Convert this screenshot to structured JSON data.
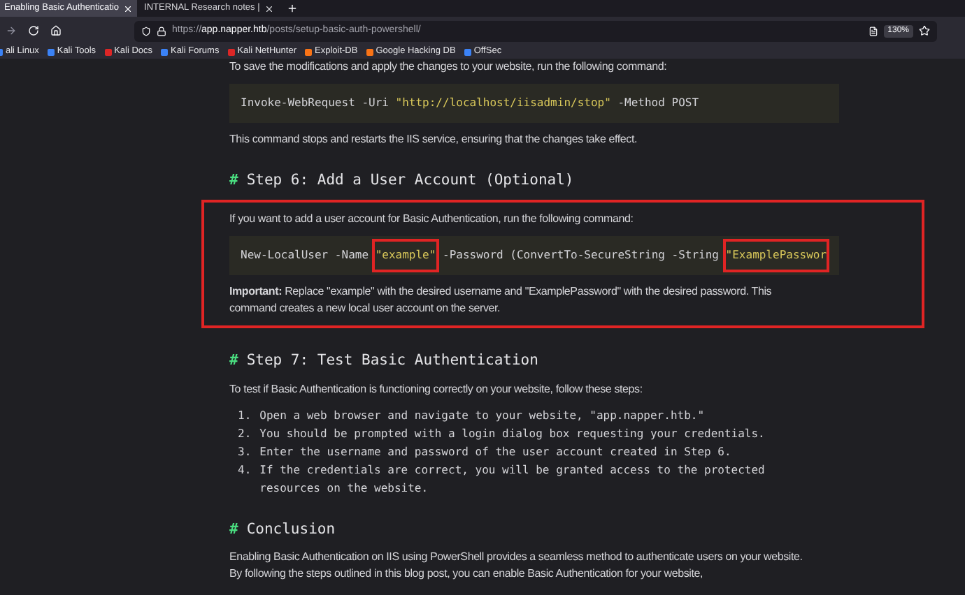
{
  "tabs": [
    {
      "label": "Enabling Basic Authenticatio",
      "selected": true
    },
    {
      "label": "INTERNAL Research notes | ",
      "selected": false
    }
  ],
  "address_bar": {
    "scheme": "https://",
    "host": "app.napper.htb",
    "path": "/posts/setup-basic-auth-powershell/",
    "zoom": "130%"
  },
  "bookmarks": [
    {
      "label": "ali Linux",
      "color": "#3b82f6"
    },
    {
      "label": "Kali Tools",
      "color": "#3b82f6"
    },
    {
      "label": "Kali Docs",
      "color": "#dc2626"
    },
    {
      "label": "Kali Forums",
      "color": "#3b82f6"
    },
    {
      "label": "Kali NetHunter",
      "color": "#dc2626"
    },
    {
      "label": "Exploit-DB",
      "color": "#f97316"
    },
    {
      "label": "Google Hacking DB",
      "color": "#f97316"
    },
    {
      "label": "OffSec",
      "color": "#3b82f6"
    }
  ],
  "article": [
    {
      "kind": "paragraph",
      "text": "To save the modifications and apply the changes to your website, run the following command:"
    },
    {
      "kind": "code",
      "tokens": [
        {
          "text": "Invoke-WebRequest -Uri ",
          "kind": "plain",
          "highlighted": false
        },
        {
          "text": "\"http://localhost/iisadmin/stop\"",
          "kind": "string",
          "highlighted": false
        },
        {
          "text": " -Method POST",
          "kind": "plain",
          "highlighted": false
        }
      ]
    },
    {
      "kind": "paragraph",
      "text": "This command stops and restarts the IIS service, ensuring that the changes take effect."
    },
    {
      "kind": "heading",
      "marker": "#",
      "text": "Step 6: Add a User Account (Optional)"
    },
    {
      "kind": "section",
      "highlighted": true,
      "children": [
        {
          "kind": "paragraph",
          "text": "If you want to add a user account for Basic Authentication, run the following command:"
        },
        {
          "kind": "code",
          "tokens": [
            {
              "text": "New-LocalUser -Name ",
              "kind": "plain",
              "highlighted": false
            },
            {
              "text": "\"example\"",
              "kind": "string",
              "highlighted": true
            },
            {
              "text": " -Password (ConvertTo-SecureString -String ",
              "kind": "plain",
              "highlighted": false
            },
            {
              "text": "\"ExamplePasswor",
              "kind": "string",
              "highlighted": true
            }
          ]
        },
        {
          "kind": "paragraph",
          "text": "**Important:** Replace \"example\" with the desired username and \"ExamplePassword\" with the desired password. This command creates a new local user account on the server."
        }
      ]
    },
    {
      "kind": "heading",
      "marker": "#",
      "text": "Step 7: Test Basic Authentication"
    },
    {
      "kind": "paragraph",
      "text": "To test if Basic Authentication is functioning correctly on your website, follow these steps:"
    },
    {
      "kind": "list",
      "items": [
        {
          "number": "1.",
          "text": "Open a web browser and navigate to your website, \"app.napper.htb.\""
        },
        {
          "number": "2.",
          "text": "You should be prompted with a login dialog box requesting your credentials."
        },
        {
          "number": "3.",
          "text": "Enter the username and password of the user account created in Step 6."
        },
        {
          "number": "4.",
          "text": "If the credentials are correct, you will be granted access to the protected resources on the website."
        }
      ]
    },
    {
      "kind": "heading",
      "marker": "#",
      "text": "Conclusion"
    },
    {
      "kind": "paragraph",
      "text": "Enabling Basic Authentication on IIS using PowerShell provides a seamless method to authenticate users on your website. By following the steps outlined in this blog post, you can enable Basic Authentication for your website,"
    }
  ]
}
